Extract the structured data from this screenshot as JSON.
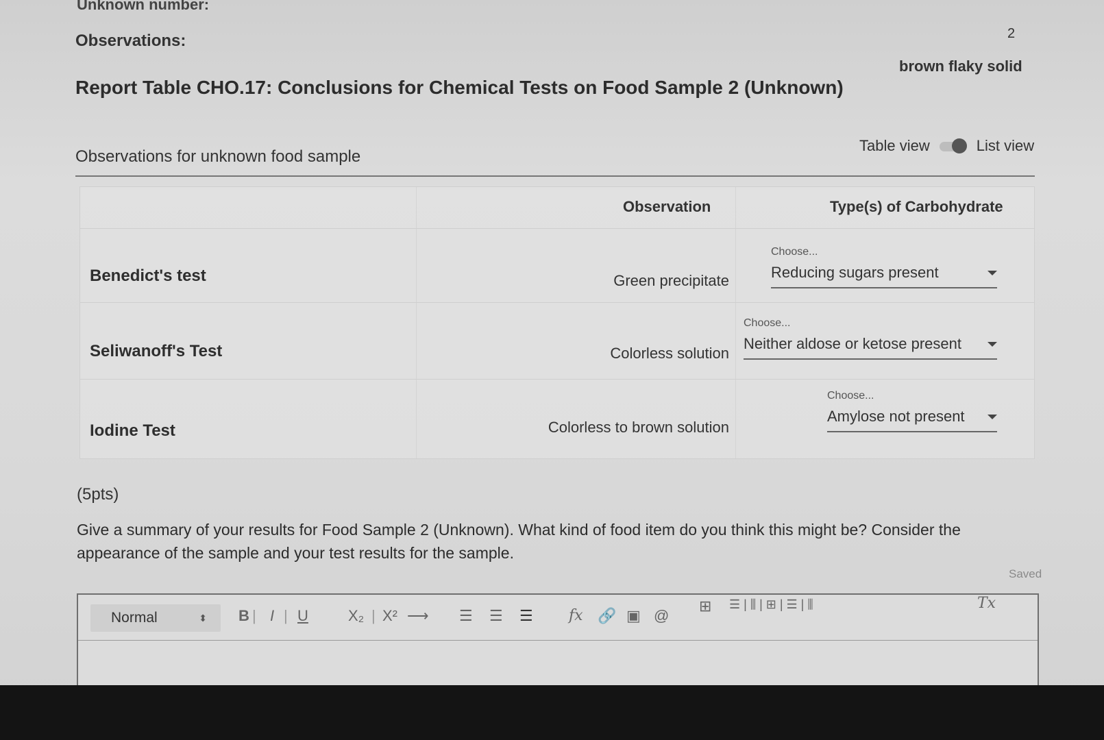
{
  "header": {
    "unknown_number_label": "Unknown number:",
    "observations_label": "Observations:",
    "unknown_number_value": "2",
    "observations_value": "brown flaky solid",
    "report_title": "Report Table CHO.17: Conclusions for Chemical Tests on Food Sample 2 (Unknown)"
  },
  "view_toggle": {
    "left": "Table view",
    "right": "List view"
  },
  "section": {
    "title": "Observations for unknown food sample"
  },
  "table": {
    "columns": [
      "Observation",
      "Type(s) of Carbohydrate"
    ],
    "rows": [
      {
        "test": "Benedict's test",
        "observation": "Green precipitate",
        "choose": "Choose...",
        "selected": "Reducing sugars present"
      },
      {
        "test": "Seliwanoff's Test",
        "observation": "Colorless solution",
        "choose": "Choose...",
        "selected": "Neither aldose or ketose present"
      },
      {
        "test": "Iodine Test",
        "observation": "Colorless to brown solution",
        "choose": "Choose...",
        "selected": "Amylose not present"
      }
    ]
  },
  "question": {
    "points": "(5pts)",
    "text": "Give a summary of your results for Food Sample 2 (Unknown). What kind of food item do you think this might be? Consider the appearance of the sample and your test results for the sample.",
    "status": "Saved"
  },
  "editor": {
    "format_select": "Normal",
    "bold": "B",
    "italic": "I",
    "underline": "U",
    "subscript": "X₂",
    "superscript": "X²",
    "arrow": "⟶",
    "ordered_list": "☰",
    "unordered_list": "☰",
    "align": "☰",
    "formula": "fx",
    "link": "🔗",
    "image": "▣",
    "at": "@",
    "table": "⊞",
    "clear_format": "Tx"
  }
}
